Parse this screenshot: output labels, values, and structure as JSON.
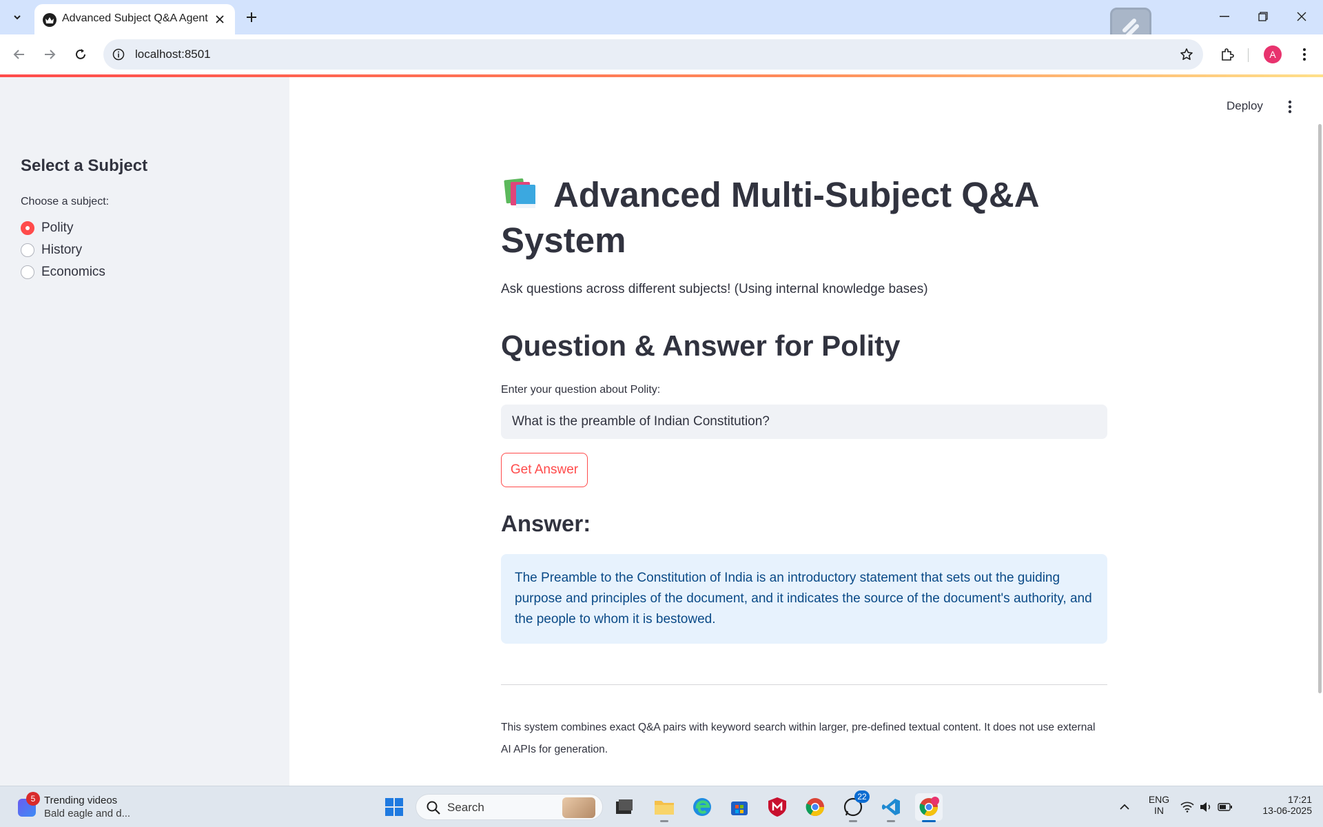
{
  "browser": {
    "tab_title": "Advanced Subject Q&A Agent",
    "url": "localhost:8501",
    "avatar_letter": "A"
  },
  "app": {
    "deploy_label": "Deploy",
    "sidebar": {
      "title": "Select a Subject",
      "radio_label": "Choose a subject:",
      "options": [
        "Polity",
        "History",
        "Economics"
      ],
      "selected": "Polity"
    },
    "main": {
      "title": "Advanced Multi-Subject Q&A System",
      "subtitle": "Ask questions across different subjects! (Using internal knowledge bases)",
      "section_title": "Question & Answer for Polity",
      "question_label": "Enter your question about Polity:",
      "question_value": "What is the preamble of Indian Constitution?",
      "button_label": "Get Answer",
      "answer_heading": "Answer:",
      "answer_text": "The Preamble to the Constitution of India is an introductory statement that sets out the guiding purpose and principles of the document, and it indicates the source of the document's authority, and the people to whom it is bestowed.",
      "footnote": "This system combines exact Q&A pairs with keyword search within larger, pre-defined textual content. It does not use external AI APIs for generation."
    }
  },
  "taskbar": {
    "widget_badge": "5",
    "widget_title": "Trending videos",
    "widget_subtitle": "Bald eagle and d...",
    "search_label": "Search",
    "whatsapp_badge": "22",
    "lang_top": "ENG",
    "lang_bottom": "IN",
    "time": "17:21",
    "date": "13-06-2025"
  },
  "colors": {
    "accent": "#ff4b4b",
    "sidebar_bg": "#f0f2f6",
    "info_bg": "#e7f2fd",
    "info_text": "#0a4a87",
    "chrome_tabstrip": "#d3e3fd"
  }
}
